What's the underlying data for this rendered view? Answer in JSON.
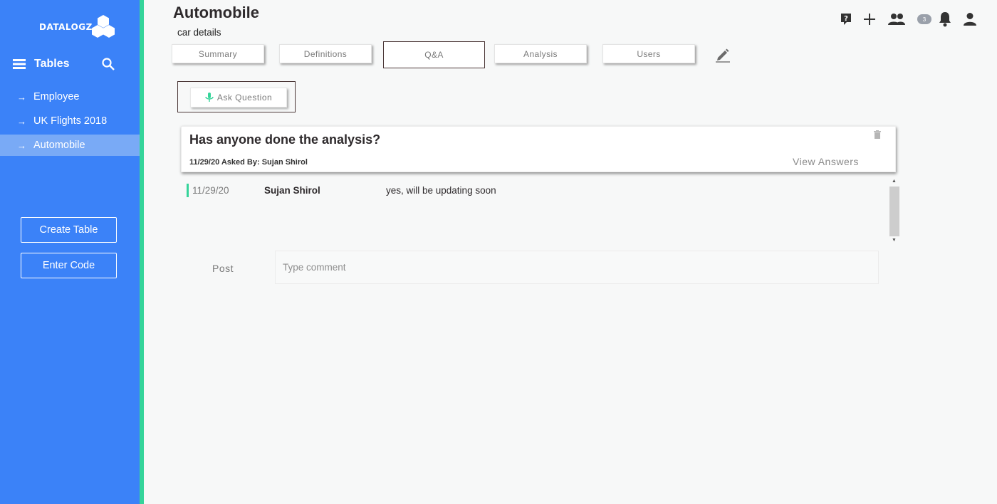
{
  "brand": {
    "logo_text": "DATALOGZ"
  },
  "sidebar": {
    "section_title": "Tables",
    "items": [
      {
        "label": "Employee",
        "active": false
      },
      {
        "label": "UK Flights 2018",
        "active": false
      },
      {
        "label": "Automobile",
        "active": true
      }
    ],
    "buttons": {
      "create_table": "Create Table",
      "enter_code": "Enter Code"
    }
  },
  "header": {
    "title": "Automobile",
    "subtitle": "car details",
    "notification_count": "3"
  },
  "tabs": [
    {
      "label": "Summary",
      "active": false
    },
    {
      "label": "Definitions",
      "active": false
    },
    {
      "label": "Q&A",
      "active": true
    },
    {
      "label": "Analysis",
      "active": false
    },
    {
      "label": "Users",
      "active": false
    }
  ],
  "qa": {
    "ask_button": "Ask Question",
    "question": {
      "title": "Has anyone done the analysis?",
      "meta": "11/29/20 Asked By: Sujan Shirol",
      "view_answers": "View Answers"
    },
    "answers": [
      {
        "date": "11/29/20",
        "author": "Sujan Shirol",
        "text": "yes, will be updating soon"
      }
    ],
    "post_label": "Post",
    "comment_placeholder": "Type comment"
  },
  "colors": {
    "sidebar": "#3b82f8",
    "sidebar_edge": "#35d49a",
    "active_item": "#79aaf6",
    "background": "#f7f8f8"
  }
}
